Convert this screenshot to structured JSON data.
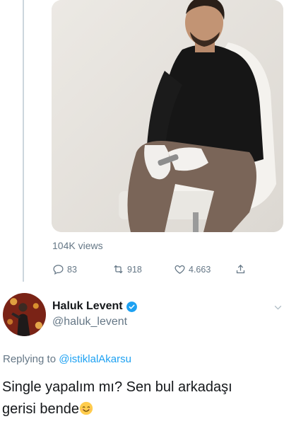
{
  "prev_tweet": {
    "media": {
      "type": "video",
      "description_icon": "video-thumbnail"
    },
    "views_text": "104K views",
    "actions": {
      "reply_count": "83",
      "retweet_count": "918",
      "like_count": "4.663"
    }
  },
  "reply": {
    "display_name": "Haluk Levent",
    "verified": true,
    "handle": "@haluk_levent",
    "replying_label": "Replying to",
    "replying_to": "@istiklalAkarsu",
    "text_line1": "Single yapalım mı? Sen bul arkadaşı",
    "text_line2": "gerisi bende",
    "emoji": "smiling-face-icon"
  },
  "colors": {
    "accent": "#1da1f2",
    "muted": "#657786",
    "text": "#14171a",
    "thread_line": "#ccd6dd"
  }
}
